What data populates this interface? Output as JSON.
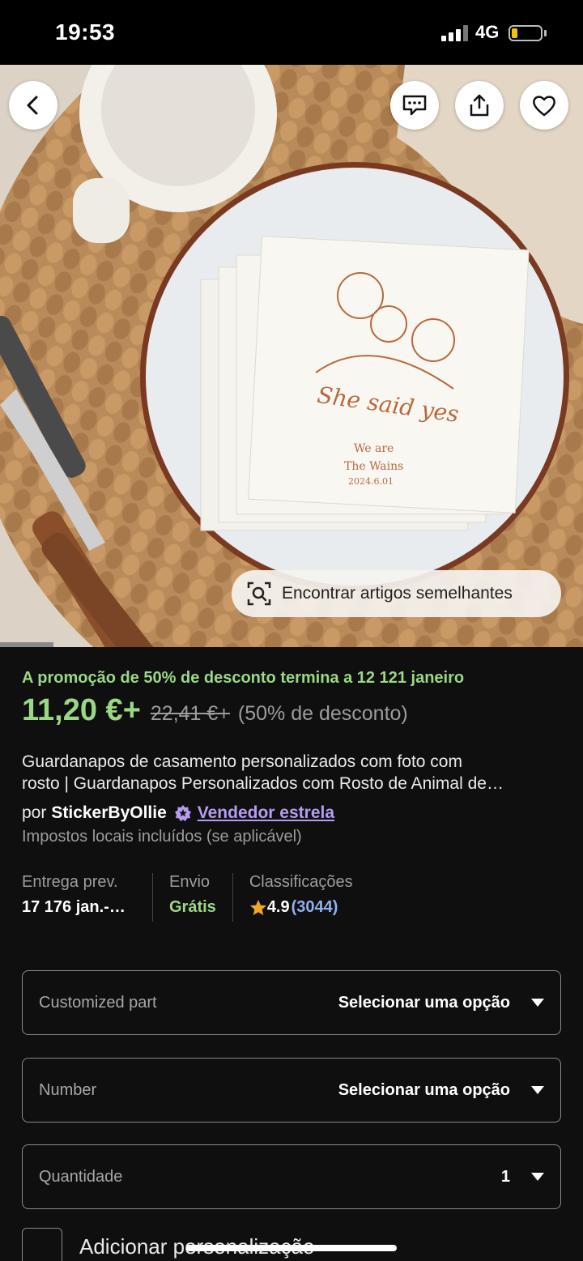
{
  "status_bar": {
    "time": "19:53",
    "network": "4G",
    "battery_level": 0.2
  },
  "hero": {
    "napkin_text": {
      "script": "She said yes",
      "line1": "We are",
      "line2": "The Wains",
      "date": "2024.6.01"
    },
    "find_similar_label": "Encontrar artigos semelhantes",
    "icons": [
      "back-arrow-icon",
      "chat-icon",
      "share-icon",
      "heart-icon",
      "camera-search-icon"
    ]
  },
  "promo": {
    "text": "A promoção de 50% de desconto termina a 12 121 janeiro"
  },
  "price": {
    "current": "11,20 €+",
    "original": "22,41 €+",
    "discount": "(50% de desconto)"
  },
  "product": {
    "title_line1": "Guardanapos de casamento personalizados com foto com",
    "title_line2": "rosto | Guardanapos Personalizados com Rosto de Animal de…"
  },
  "seller": {
    "prefix": "por",
    "name": "StickerByOllie",
    "badge": "Vendedor estrela"
  },
  "tax_note": "Impostos locais incluídos (se aplicável)",
  "info": {
    "delivery": {
      "label": "Entrega prev.",
      "value": "17 176 jan.-…"
    },
    "shipping": {
      "label": "Envio",
      "value": "Grátis"
    },
    "ratings": {
      "label": "Classificações",
      "value": "4.9",
      "count": "(3044)"
    }
  },
  "options": [
    {
      "label": "Customized part",
      "value": "Selecionar uma opção"
    },
    {
      "label": "Number",
      "value": "Selecionar uma opção"
    },
    {
      "label": "Quantidade",
      "value": "1"
    }
  ],
  "personalization": {
    "label": "Adicionar personalização"
  },
  "colors": {
    "accent_green": "#9ad884",
    "link_purple": "#b69cf0",
    "rating_blue": "#8fb1ef",
    "background": "#0f0f0f"
  }
}
